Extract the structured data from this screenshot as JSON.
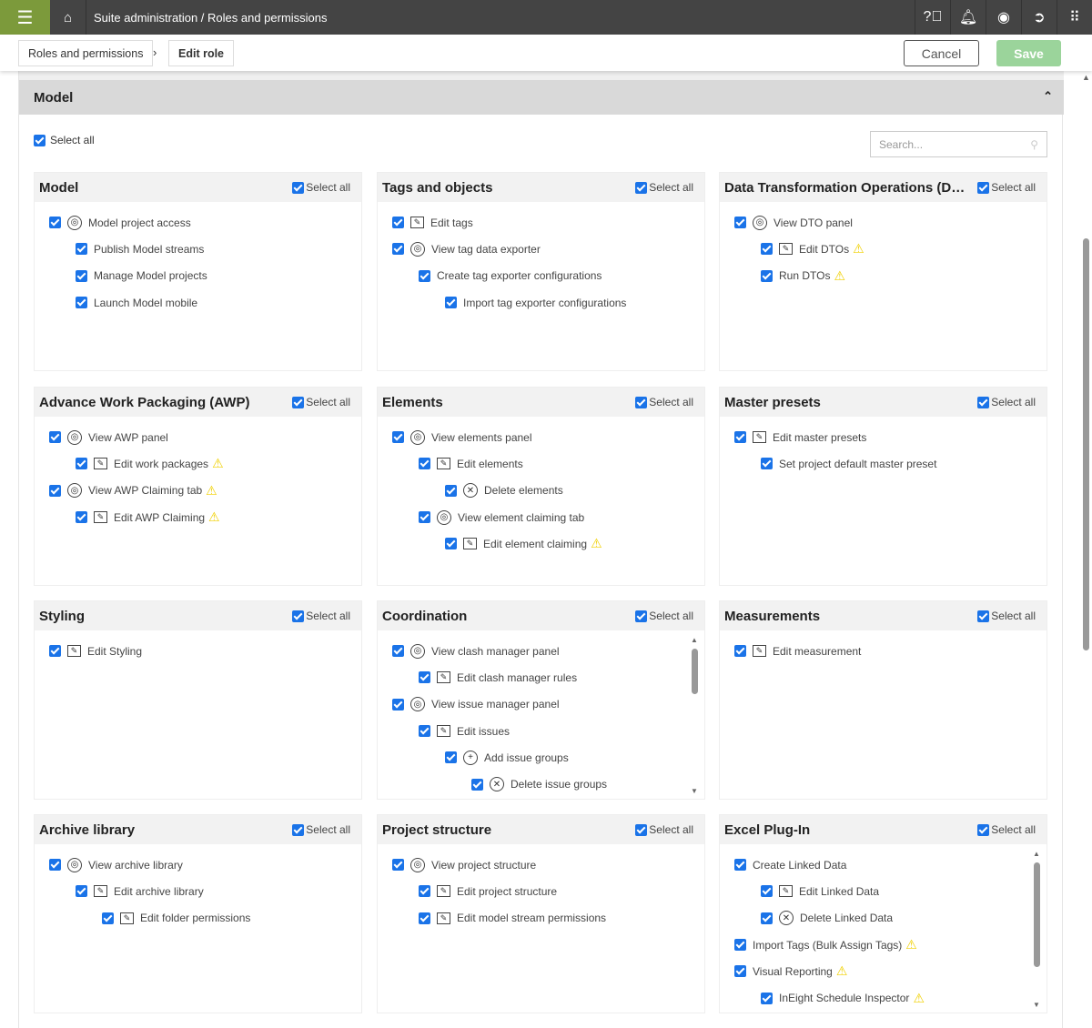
{
  "topbar": {
    "breadcrumb": "Suite administration  /  Roles and permissions",
    "icons": [
      "help-icon",
      "bell-icon",
      "user-icon",
      "signout-icon",
      "apps-icon"
    ]
  },
  "subbar": {
    "crumb1": "Roles and permissions",
    "crumb2": "Edit role",
    "cancel": "Cancel",
    "save": "Save"
  },
  "section": {
    "title": "Model",
    "select_all": "Select all",
    "search_placeholder": "Search..."
  },
  "card_select_all": "Select all",
  "cards": [
    {
      "title": "Model",
      "items": [
        {
          "l": 0,
          "i": "eye",
          "t": "Model project access"
        },
        {
          "l": 1,
          "i": "",
          "t": "Publish Model streams"
        },
        {
          "l": 1,
          "i": "",
          "t": "Manage Model projects"
        },
        {
          "l": 1,
          "i": "",
          "t": "Launch Model mobile"
        }
      ]
    },
    {
      "title": "Tags and objects",
      "items": [
        {
          "l": 0,
          "i": "edit",
          "t": "Edit tags"
        },
        {
          "l": 0,
          "i": "eye",
          "t": "View tag data exporter"
        },
        {
          "l": 1,
          "i": "",
          "t": "Create tag exporter configurations"
        },
        {
          "l": 2,
          "i": "",
          "t": "Import tag exporter configurations"
        }
      ]
    },
    {
      "title": "Data Transformation Operations (DTO)",
      "items": [
        {
          "l": 0,
          "i": "eye",
          "t": "View DTO panel"
        },
        {
          "l": 1,
          "i": "edit",
          "t": "Edit DTOs",
          "w": true
        },
        {
          "l": 1,
          "i": "",
          "t": "Run DTOs",
          "w": true
        }
      ]
    },
    {
      "title": "Advance Work Packaging (AWP)",
      "items": [
        {
          "l": 0,
          "i": "eye",
          "t": "View AWP panel"
        },
        {
          "l": 1,
          "i": "edit",
          "t": "Edit work packages",
          "w": true
        },
        {
          "l": 0,
          "i": "eye",
          "t": "View AWP Claiming tab",
          "w": true
        },
        {
          "l": 1,
          "i": "edit",
          "t": "Edit AWP Claiming",
          "w": true
        }
      ]
    },
    {
      "title": "Elements",
      "items": [
        {
          "l": 0,
          "i": "eye",
          "t": "View elements panel"
        },
        {
          "l": 1,
          "i": "edit",
          "t": "Edit elements"
        },
        {
          "l": 2,
          "i": "x",
          "t": "Delete elements"
        },
        {
          "l": 1,
          "i": "eye",
          "t": "View element claiming tab"
        },
        {
          "l": 2,
          "i": "edit",
          "t": "Edit element claiming",
          "w": true
        }
      ]
    },
    {
      "title": "Master presets",
      "items": [
        {
          "l": 0,
          "i": "edit",
          "t": "Edit master presets"
        },
        {
          "l": 1,
          "i": "",
          "t": "Set project default master preset"
        }
      ]
    },
    {
      "title": "Styling",
      "items": [
        {
          "l": 0,
          "i": "edit",
          "t": "Edit Styling"
        }
      ]
    },
    {
      "title": "Coordination",
      "scroll": true,
      "items": [
        {
          "l": 0,
          "i": "eye",
          "t": "View clash manager panel"
        },
        {
          "l": 1,
          "i": "edit",
          "t": "Edit clash manager rules"
        },
        {
          "l": 0,
          "i": "eye",
          "t": "View issue manager panel"
        },
        {
          "l": 1,
          "i": "edit",
          "t": "Edit issues"
        },
        {
          "l": 2,
          "i": "plus",
          "t": "Add issue groups"
        },
        {
          "l": 3,
          "i": "x",
          "t": "Delete issue groups"
        }
      ]
    },
    {
      "title": "Measurements",
      "items": [
        {
          "l": 0,
          "i": "edit",
          "t": "Edit measurement"
        }
      ]
    },
    {
      "title": "Archive library",
      "items": [
        {
          "l": 0,
          "i": "eye",
          "t": "View archive library"
        },
        {
          "l": 1,
          "i": "edit",
          "t": "Edit archive library"
        },
        {
          "l": 2,
          "i": "edit",
          "t": "Edit folder permissions"
        }
      ]
    },
    {
      "title": "Project structure",
      "items": [
        {
          "l": 0,
          "i": "eye",
          "t": "View project structure"
        },
        {
          "l": 1,
          "i": "edit",
          "t": "Edit project structure"
        },
        {
          "l": 1,
          "i": "edit",
          "t": "Edit model stream permissions"
        }
      ]
    },
    {
      "title": "Excel Plug-In",
      "scroll": true,
      "items": [
        {
          "l": 0,
          "i": "",
          "t": "Create Linked Data"
        },
        {
          "l": 1,
          "i": "edit",
          "t": "Edit Linked Data"
        },
        {
          "l": 1,
          "i": "x",
          "t": "Delete Linked Data"
        },
        {
          "l": 0,
          "i": "",
          "t": "Import Tags (Bulk Assign Tags)",
          "w": true
        },
        {
          "l": 0,
          "i": "",
          "t": "Visual Reporting",
          "w": true
        },
        {
          "l": 1,
          "i": "",
          "t": "InEight Schedule Inspector",
          "w": true
        }
      ]
    }
  ]
}
